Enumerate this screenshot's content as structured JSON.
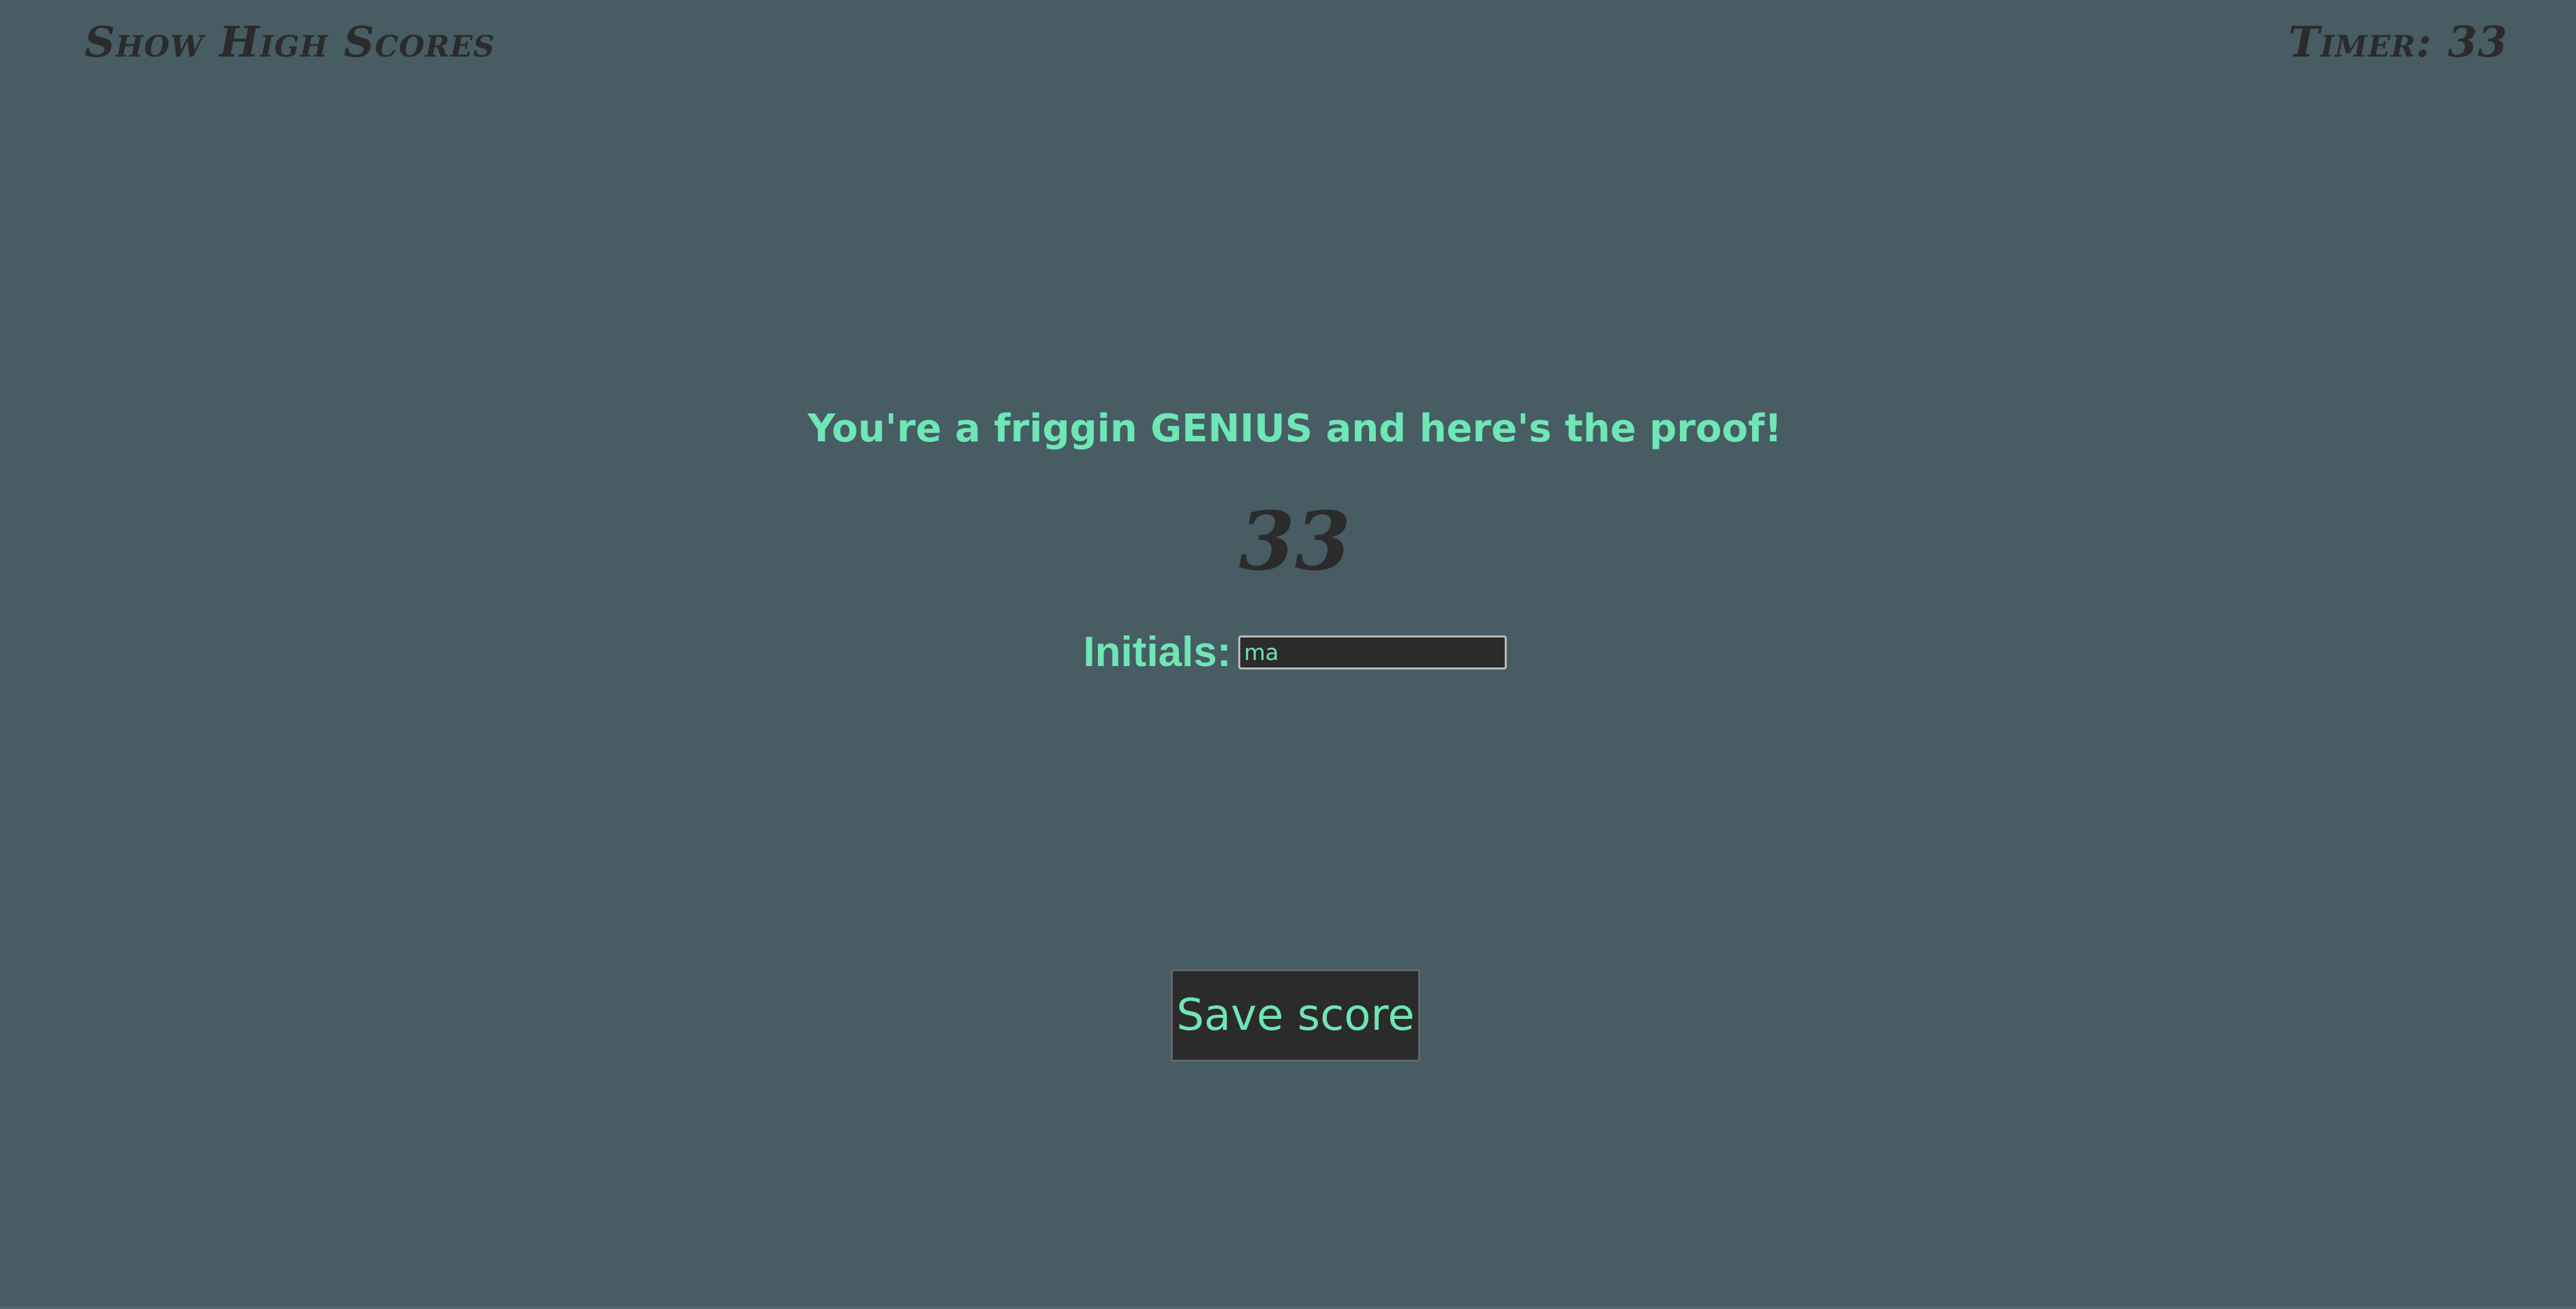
{
  "header": {
    "high_scores_link": "Show High Scores",
    "timer_text": "Timer: 33"
  },
  "result": {
    "headline": "You're a friggin GENIUS and here's the proof!",
    "score": "33"
  },
  "form": {
    "initials_label": "Initials:",
    "initials_value": "ma",
    "save_label": "Save score"
  },
  "colors": {
    "background": "#475c63",
    "accent": "#6ee6b5",
    "dark": "#2b2b2b"
  }
}
